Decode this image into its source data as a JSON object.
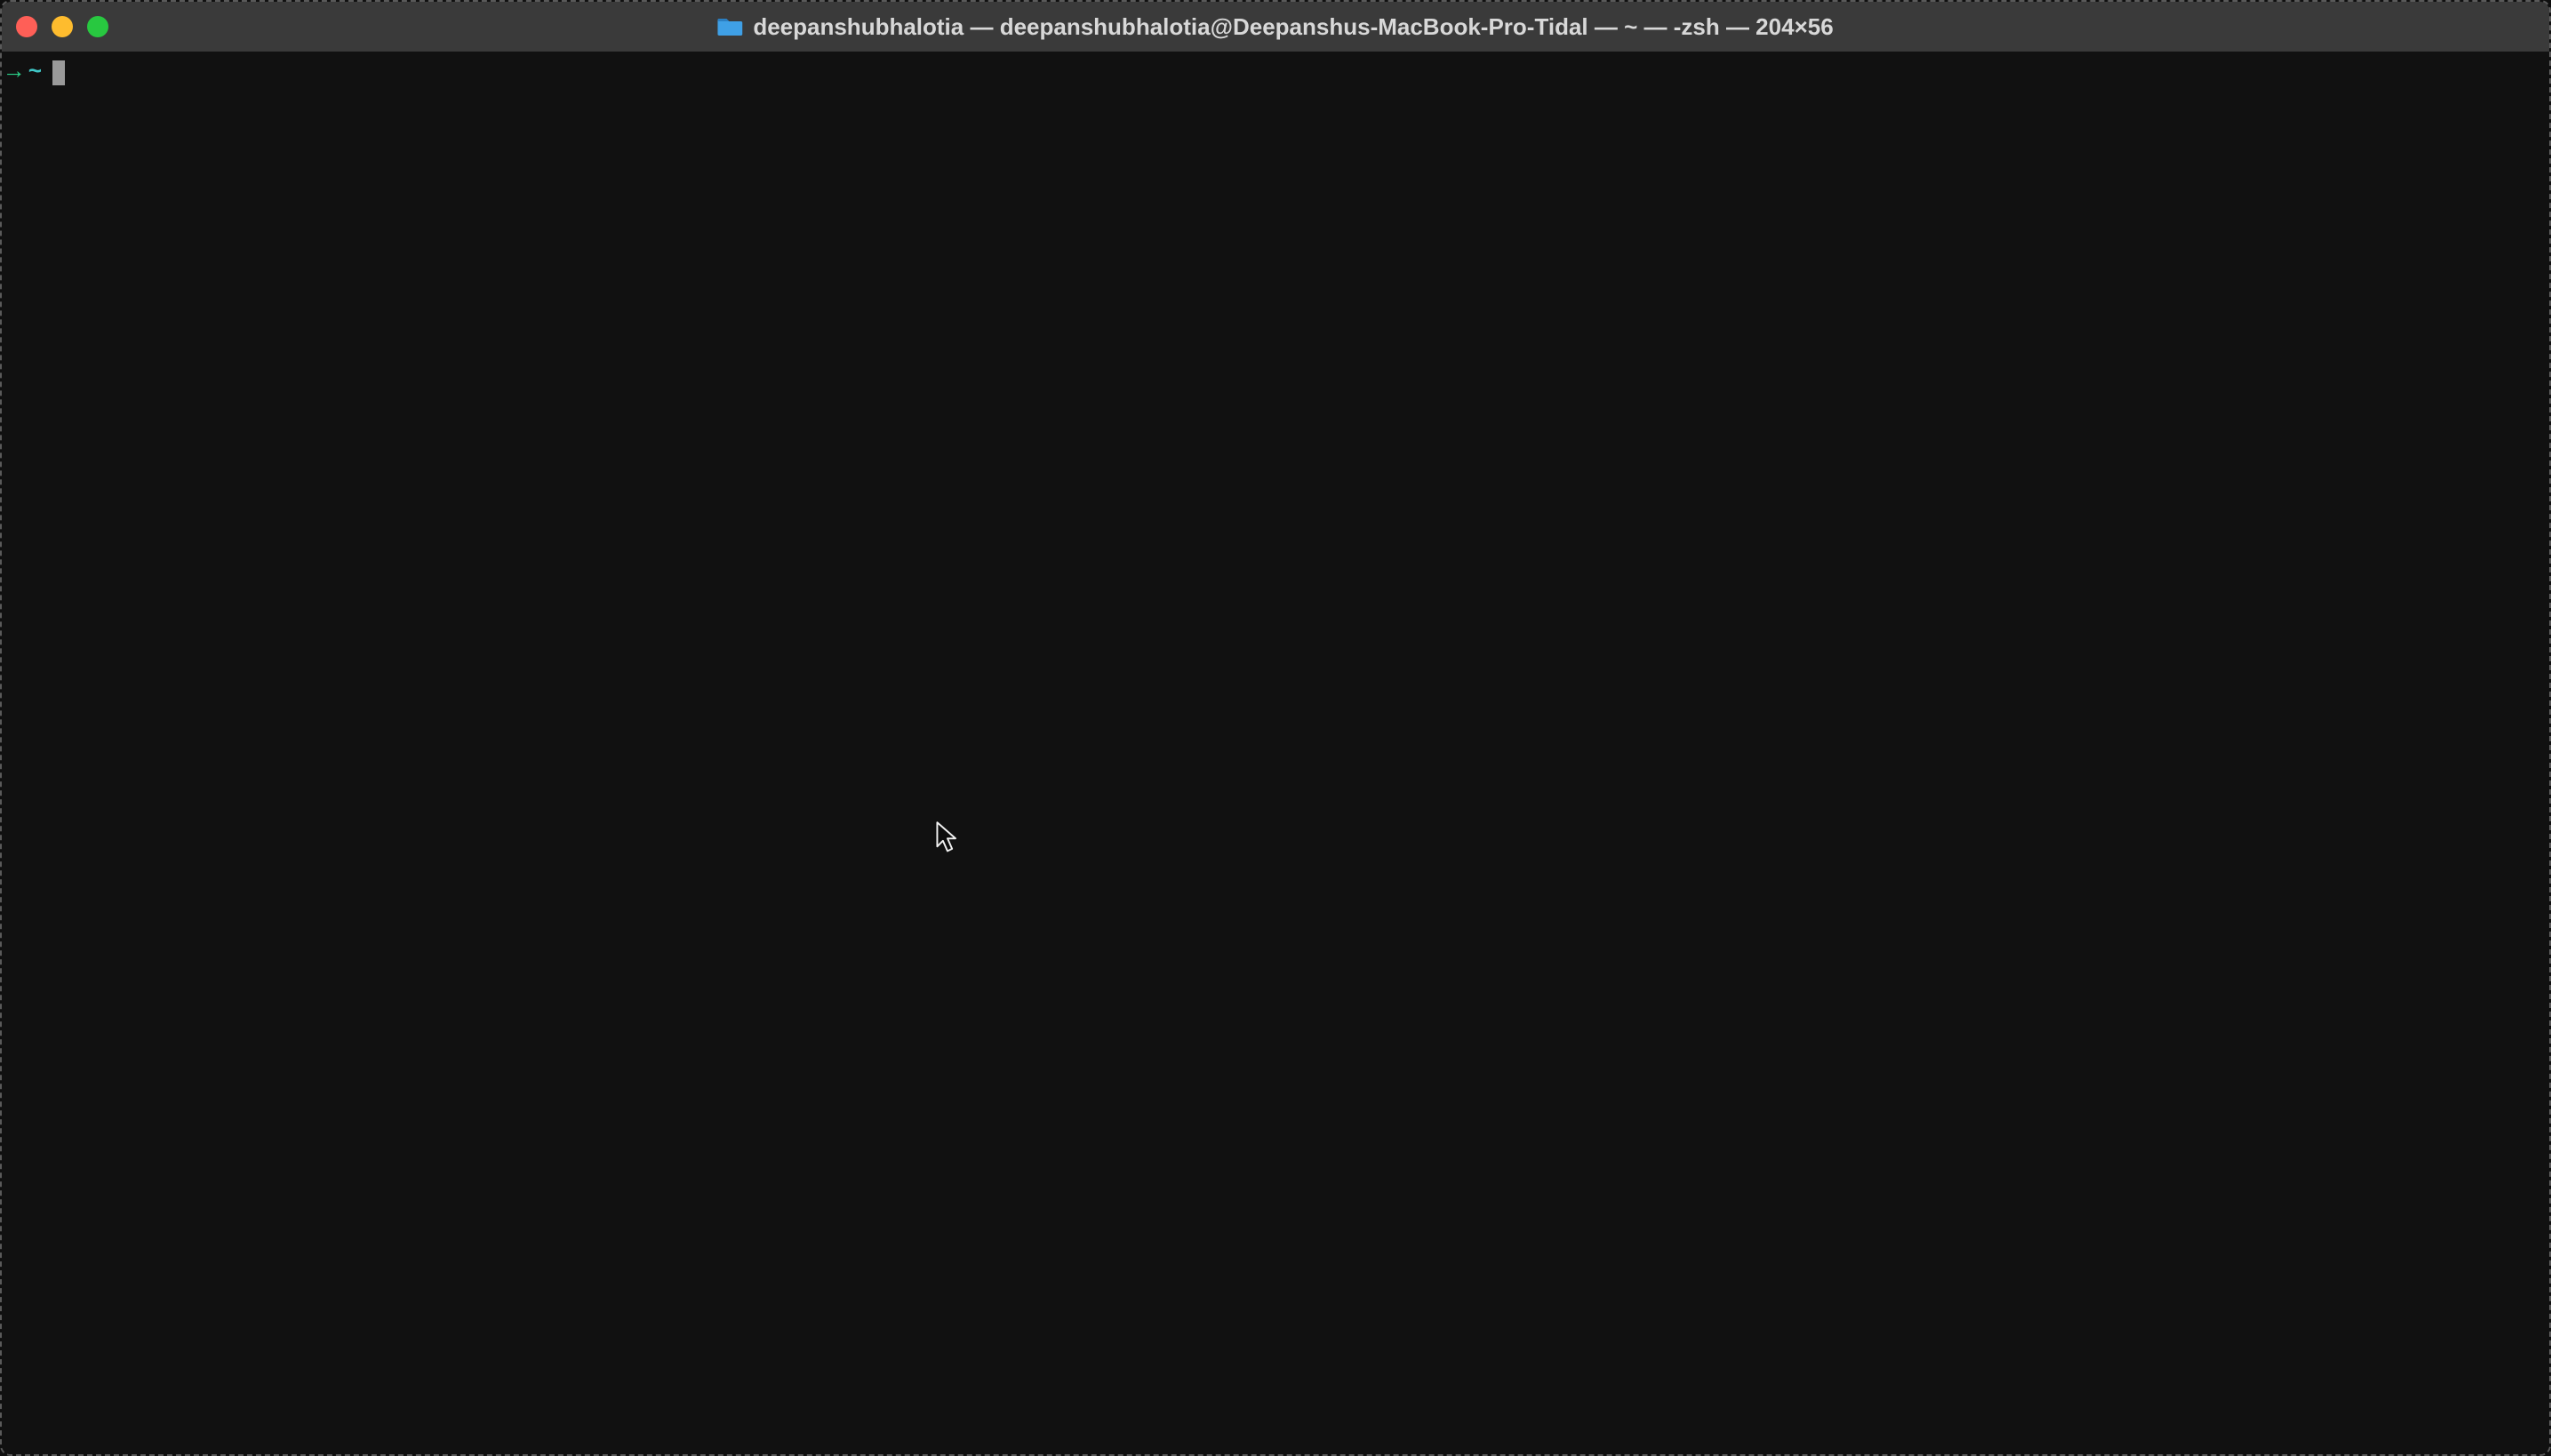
{
  "window": {
    "title": "deepanshubhalotia — deepanshubhalotia@Deepanshus-MacBook-Pro-Tidal — ~ — -zsh — 204×56"
  },
  "prompt": {
    "arrow": "→",
    "path": "~"
  },
  "colors": {
    "bg": "#111111",
    "titlebar": "#3a3a3a",
    "close": "#ff5f57",
    "minimize": "#febc2e",
    "maximize": "#28c840",
    "prompt_arrow": "#2bd38a",
    "prompt_path": "#3fc7c7",
    "cursor": "#9a9a9a",
    "title_text": "#d8d8d8"
  }
}
